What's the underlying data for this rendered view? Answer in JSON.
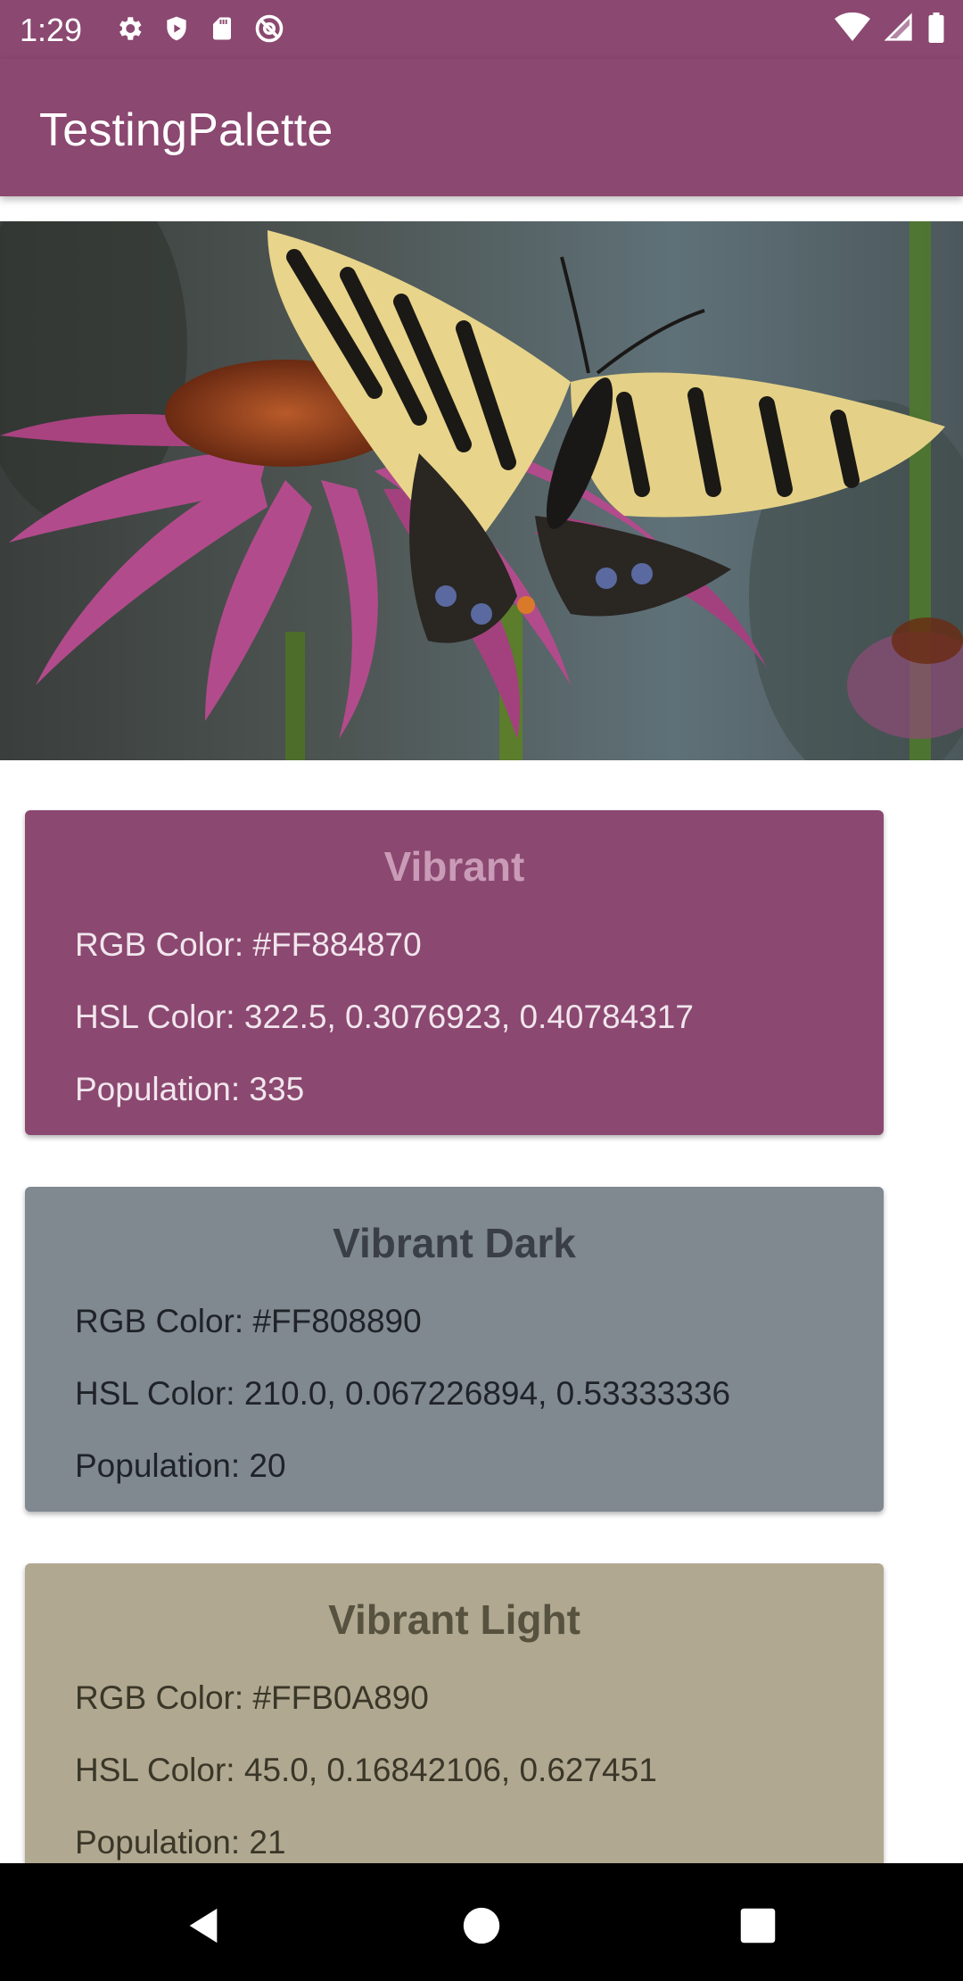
{
  "status_bar": {
    "time": "1:29",
    "left_icons": [
      "gear-icon",
      "shield-play-icon",
      "sd-card-icon",
      "at-sign-icon"
    ],
    "right_icons": [
      "wifi-icon",
      "cellular-signal-icon",
      "battery-icon"
    ]
  },
  "app_bar": {
    "title": "TestingPalette",
    "color": "#8b4870"
  },
  "hero_image": {
    "subject": "butterfly-on-coneflower-image"
  },
  "swatches": [
    {
      "title": "Vibrant",
      "rgb": "RGB Color: #FF884870",
      "hsl": "HSL Color: 322.5, 0.3076923, 0.40784317",
      "population": "Population: 335",
      "background": "#884870"
    },
    {
      "title": "Vibrant Dark",
      "rgb": "RGB Color: #FF808890",
      "hsl": "HSL Color: 210.0, 0.067226894, 0.53333336",
      "population": "Population: 20",
      "background": "#808890"
    },
    {
      "title": "Vibrant Light",
      "rgb": "RGB Color: #FFB0A890",
      "hsl": "HSL Color: 45.0, 0.16842106, 0.627451",
      "population": "Population: 21",
      "background": "#B0A890"
    }
  ],
  "nav_bar": {
    "buttons": [
      "back-icon",
      "home-icon",
      "recents-icon"
    ]
  }
}
